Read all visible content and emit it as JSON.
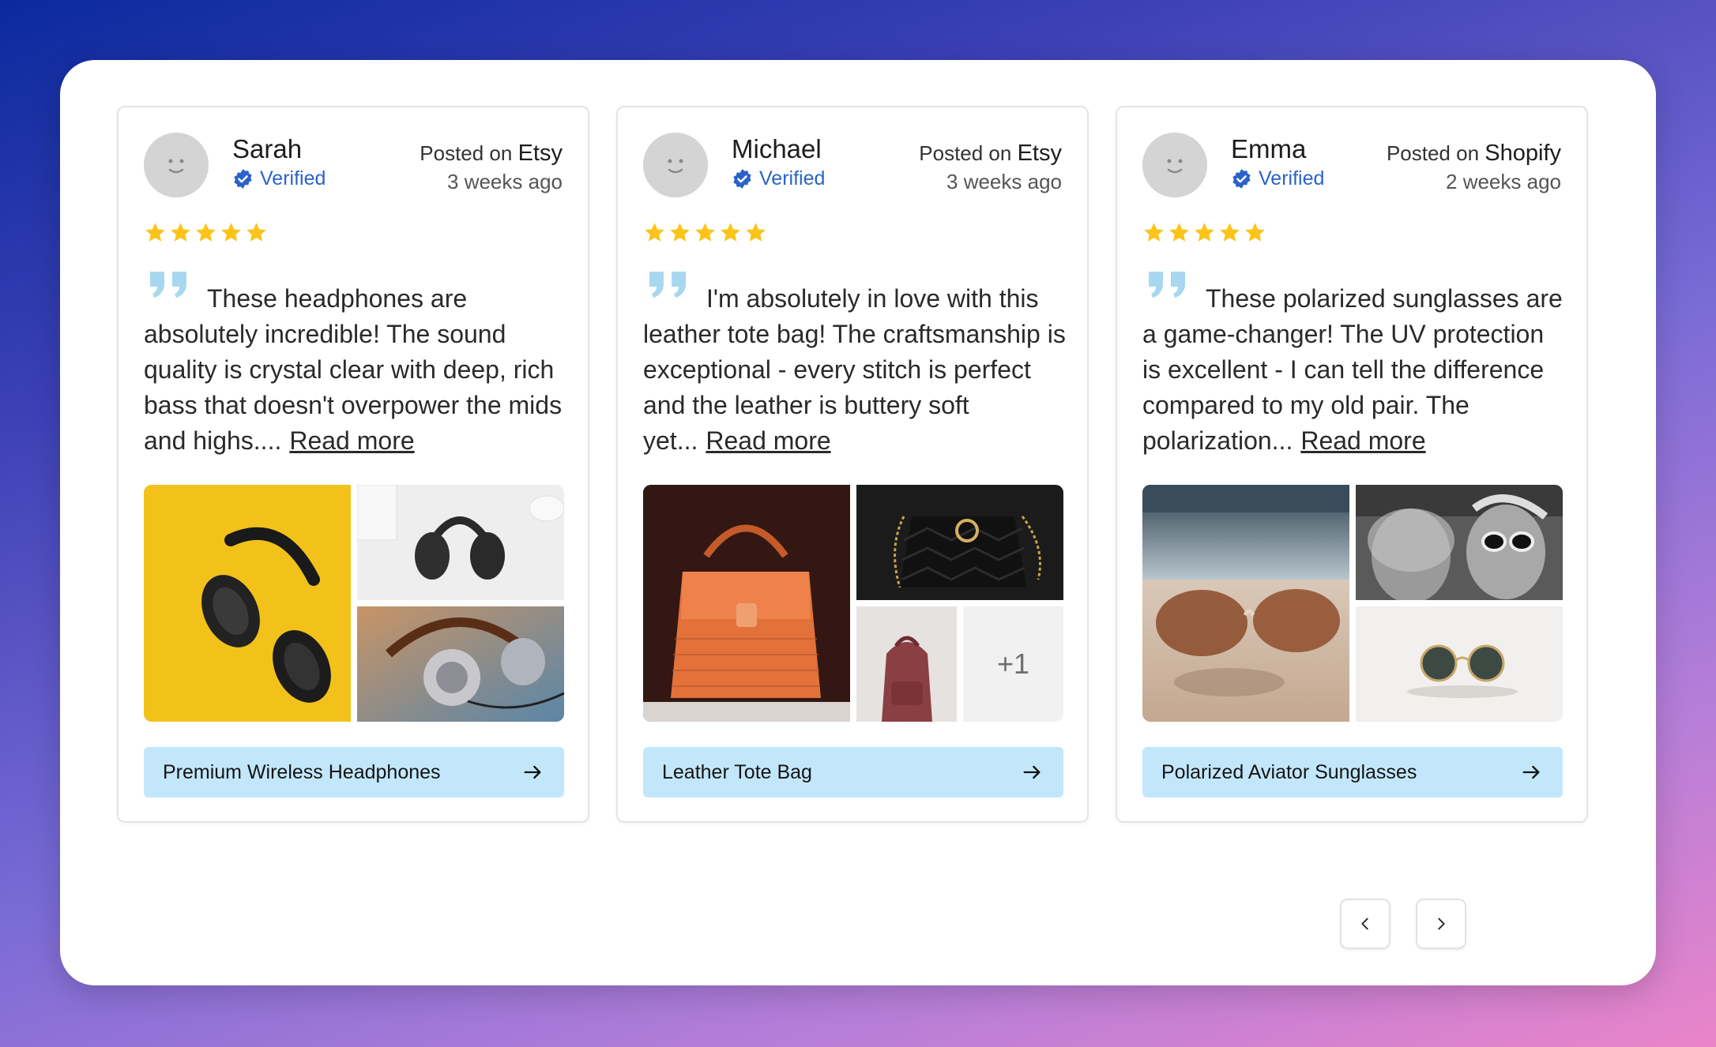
{
  "reviews": [
    {
      "name": "Sarah",
      "verified_label": "Verified",
      "posted_prefix": "Posted on",
      "platform": "Etsy",
      "time_ago": "3 weeks ago",
      "rating": 5,
      "text": "These headphones are absolutely incredible! The sound quality is crystal clear with deep, rich bass that doesn't overpower the mids and highs....",
      "read_more": "Read more",
      "product": "Premium Wireless Headphones",
      "images": [
        "yellow-headphones-photo",
        "white-desk-headphones-photo",
        "retro-headphones-photo"
      ]
    },
    {
      "name": "Michael",
      "verified_label": "Verified",
      "posted_prefix": "Posted on",
      "platform": "Etsy",
      "time_ago": "3 weeks ago",
      "rating": 5,
      "text": "I'm absolutely in love with this leather tote bag! The craftsmanship is exceptional - every stitch is perfect and the leather is buttery soft yet...",
      "read_more": "Read more",
      "product": "Leather Tote Bag",
      "images": [
        "orange-wicker-bag-photo",
        "black-quilted-bag-photo",
        "red-backpack-photo"
      ],
      "more_count": "+1"
    },
    {
      "name": "Emma",
      "verified_label": "Verified",
      "posted_prefix": "Posted on",
      "platform": "Shopify",
      "time_ago": "2 weeks ago",
      "rating": 5,
      "text": "These polarized sunglasses are a game-changer! The UV protection is excellent - I can tell the difference compared to my old pair. The polarization...",
      "read_more": "Read more",
      "product": "Polarized Aviator Sunglasses",
      "images": [
        "sunglasses-on-sand-photo",
        "women-in-sunglasses-photo",
        "round-sunglasses-photo"
      ]
    }
  ],
  "colors": {
    "accent_button": "#c2e7fb",
    "star": "#fcc419",
    "verified": "#2b62c8",
    "quote": "#a8d8f0"
  },
  "icons": {
    "prev": "chevron-left-icon",
    "next": "chevron-right-icon",
    "product_link": "arrow-right-icon",
    "verified": "verified-check-icon",
    "quote": "quote-icon"
  }
}
